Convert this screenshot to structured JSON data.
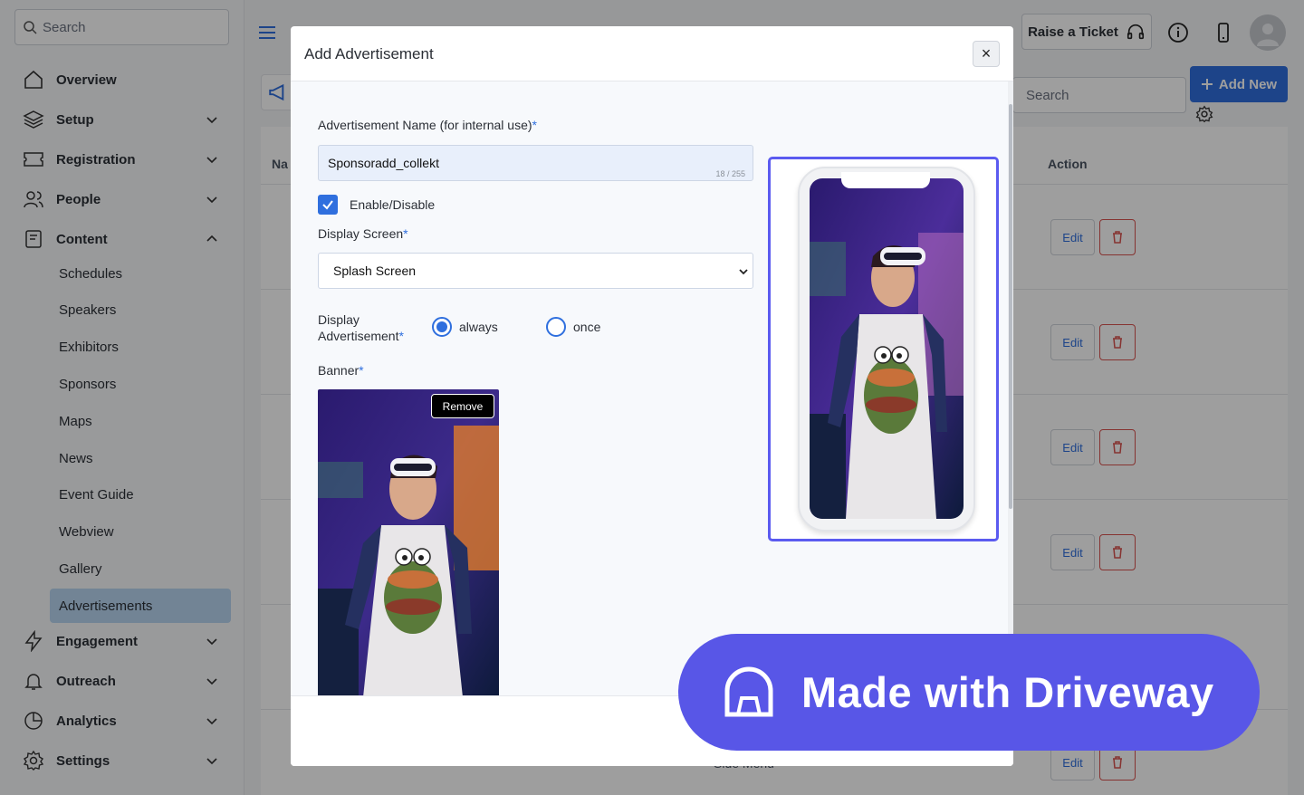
{
  "sidebar": {
    "search_placeholder": "Search",
    "items": [
      {
        "label": "Overview",
        "icon": "home-icon"
      },
      {
        "label": "Setup",
        "icon": "layers-icon"
      },
      {
        "label": "Registration",
        "icon": "ticket-icon"
      },
      {
        "label": "People",
        "icon": "people-icon"
      },
      {
        "label": "Content",
        "icon": "document-icon"
      },
      {
        "label": "Engagement",
        "icon": "bolt-icon"
      },
      {
        "label": "Outreach",
        "icon": "bell-icon"
      },
      {
        "label": "Analytics",
        "icon": "pie-chart-icon"
      },
      {
        "label": "Settings",
        "icon": "gear-icon"
      }
    ],
    "content_subitems": [
      "Schedules",
      "Speakers",
      "Exhibitors",
      "Sponsors",
      "Maps",
      "News",
      "Event Guide",
      "Webview",
      "Gallery",
      "Advertisements"
    ],
    "active_subitem": "Advertisements"
  },
  "header": {
    "raise_ticket_label": "Raise a Ticket"
  },
  "page": {
    "search_placeholder": "Search",
    "add_new_label": "Add New",
    "table_header_name": "Na",
    "table_header_action": "Action",
    "edit_label": "Edit",
    "row_partial_text": "Side Menu"
  },
  "modal": {
    "title": "Add Advertisement",
    "close_label": "×",
    "name_label": "Advertisement Name (for internal use)",
    "name_value": "Sponsoradd_collekt",
    "name_counter": "18 / 255",
    "enable_label": "Enable/Disable",
    "enabled": true,
    "display_screen_label": "Display Screen",
    "display_screen_value": "Splash Screen",
    "display_ad_label_line1": "Display",
    "display_ad_label_line2": "Advertisement",
    "option_always": "always",
    "option_once": "once",
    "selected_option": "always",
    "banner_label": "Banner",
    "remove_label": "Remove",
    "required_mark": "*"
  },
  "badge": {
    "text": "Made with Driveway"
  },
  "colors": {
    "accent": "#2f6fde",
    "preview_border": "#5b5bf0",
    "badge": "#5856e7",
    "delete": "#d9534f"
  }
}
